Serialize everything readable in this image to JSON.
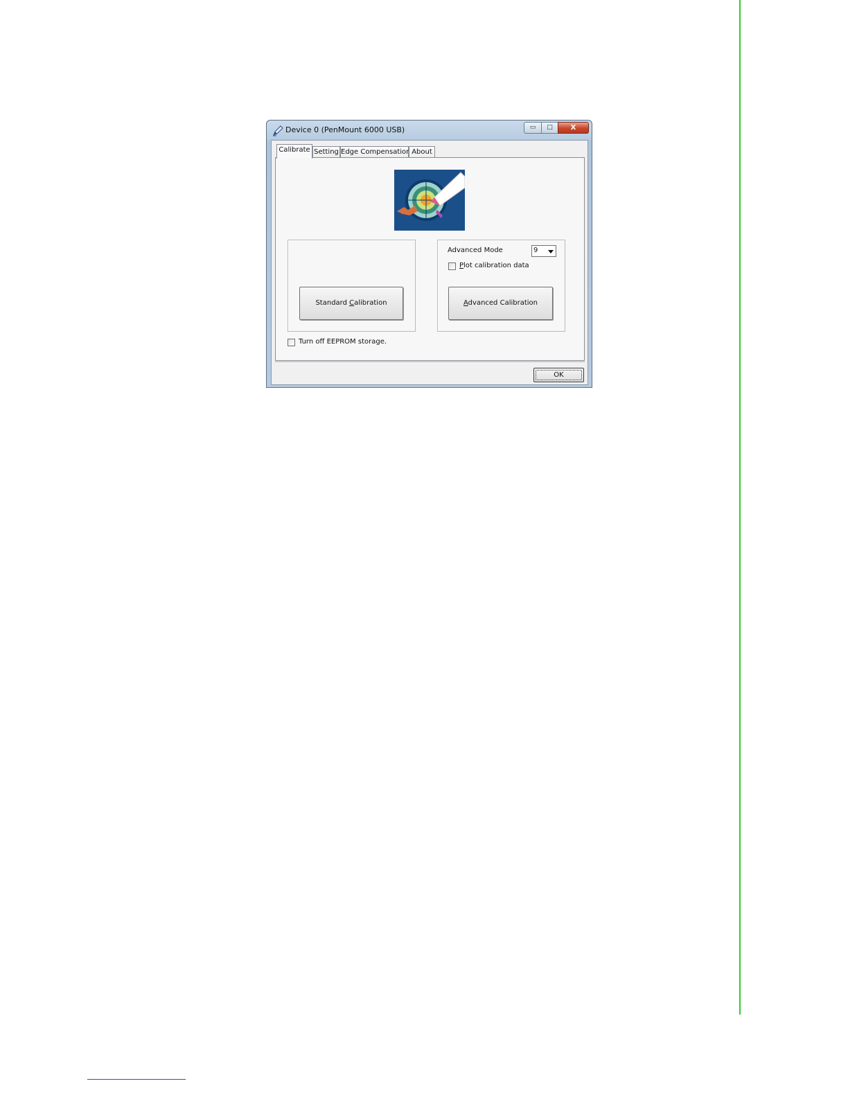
{
  "window": {
    "title": "Device 0 (PenMount 6000 USB)",
    "minimize_glyph": "▭",
    "maximize_glyph": "□",
    "close_glyph": "X"
  },
  "tabs": [
    {
      "label": "Calibrate",
      "active": true
    },
    {
      "label": "Setting",
      "active": false
    },
    {
      "label": "Edge Compensation",
      "active": false
    },
    {
      "label": "About",
      "active": false
    }
  ],
  "calibrate": {
    "standard_button": {
      "pre": "Standard ",
      "mnemonic": "C",
      "post": "alibration"
    },
    "advanced_mode_label": "Advanced Mode",
    "advanced_mode_value": "9",
    "plot_checkbox": {
      "mnemonic": "P",
      "post": "lot calibration data",
      "checked": false
    },
    "advanced_button": {
      "mnemonic": "A",
      "post": "dvanced Calibration"
    },
    "eeprom_checkbox": {
      "label": "Turn off EEPROM storage.",
      "checked": false
    }
  },
  "footer": {
    "ok_label": "OK"
  },
  "colors": {
    "accent_rule": "#33cc33",
    "close_button": "#c9462c",
    "logo_background": "#1b4f8a"
  },
  "icons": {
    "app": "pen-icon",
    "logo": "target-calibration-icon",
    "dropdown": "chevron-down-icon"
  }
}
